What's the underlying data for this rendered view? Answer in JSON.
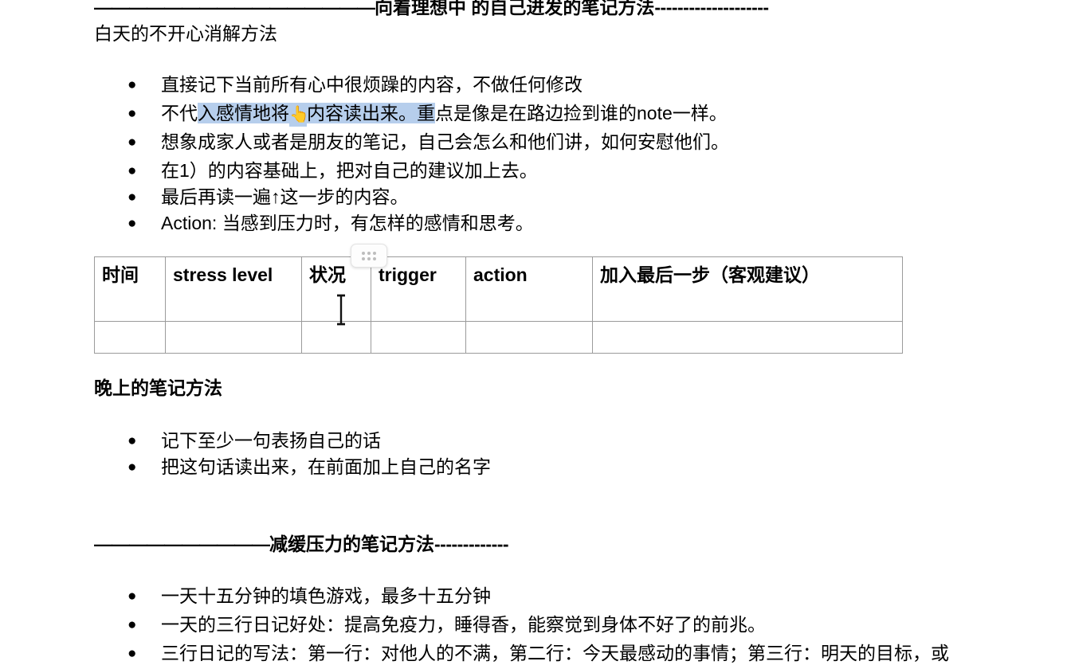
{
  "document": {
    "top_heading": {
      "lead_rule": "————————————————",
      "title": "向着理想中 的自己进发的笔记方法",
      "trail_rule": "--------------------"
    },
    "section_1": {
      "title": "白天的不开心消解方法",
      "bullets": [
        {
          "text": "直接记下当前所有心中很烦躁的内容，不做任何修改"
        },
        {
          "parts": [
            {
              "text": "不代",
              "selected": false
            },
            {
              "text": "入感情地将",
              "selected": true
            },
            {
              "text": "👆",
              "selected": true,
              "emoji": true
            },
            {
              "text": "内容读出来。重",
              "selected": true
            },
            {
              "text": "点是像是在路边捡到谁的note一样。",
              "selected": false
            }
          ]
        },
        {
          "text": "想象成家人或者是朋友的笔记，自己会怎么和他们讲，如何安慰他们。"
        },
        {
          "text": "在1）的内容基础上，把对自己的建议加上去。"
        },
        {
          "text": "最后再读一遍↑这一步的内容。"
        },
        {
          "text": "Action: 当感到压力时，有怎样的感情和思考。"
        }
      ]
    },
    "table": {
      "headers": [
        "时间",
        "stress level",
        "状况",
        "trigger",
        "action",
        "加入最后一步（客观建议）"
      ],
      "rows": [
        [
          "",
          "",
          "",
          "",
          "",
          ""
        ]
      ],
      "drag_handle_label": "drag-handle"
    },
    "section_2": {
      "title": "晚上的笔记方法",
      "bullets": [
        {
          "text": "记下至少一句表扬自己的话"
        },
        {
          "text": "把这句话读出来，在前面加上自己的名字"
        }
      ]
    },
    "section_3": {
      "heading": {
        "lead_rule": "——————————",
        "title": "减缓压力的笔记方法",
        "trail_rule": "-------------"
      },
      "bullets": [
        {
          "text": "一天十五分钟的填色游戏，最多十五分钟"
        },
        {
          "text": "一天的三行日记好处：提高免疫力，睡得香，能察觉到身体不好了的前兆。"
        },
        {
          "text": "三行日记的写法：第一行：对他人的不满，第二行：今天最感动的事情；第三行：明天的目标，或"
        }
      ]
    }
  }
}
